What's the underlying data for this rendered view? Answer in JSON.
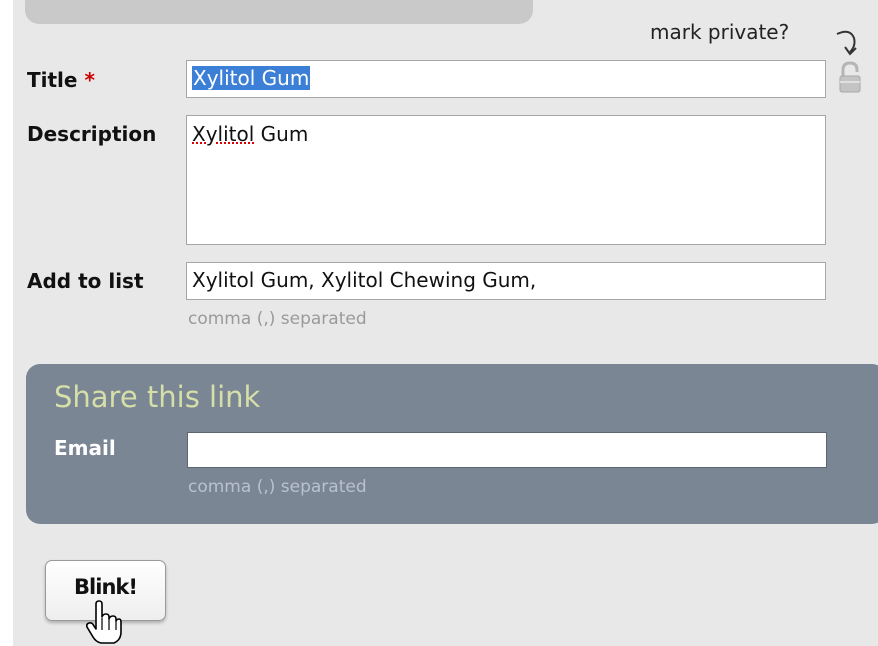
{
  "form": {
    "mark_private_label": "mark private?",
    "title": {
      "label": "Title",
      "required_marker": "*",
      "value": "Xylitol Gum"
    },
    "description": {
      "label": "Description",
      "value_word1": "Xylitol",
      "value_word2": " Gum"
    },
    "add_to_list": {
      "label": "Add to list",
      "value": "Xylitol Gum, Xylitol Chewing Gum,",
      "hint": "comma (,) separated"
    }
  },
  "share": {
    "heading": "Share this link",
    "email_label": "Email",
    "email_value": "",
    "hint": "comma (,) separated"
  },
  "submit_button": {
    "label": "Blink!"
  },
  "colors": {
    "panel_bg": "#e8e8e8",
    "share_bg": "#7a8694",
    "share_heading": "#d6dfa8",
    "required": "#cc0000",
    "selection": "#3b80d6"
  }
}
